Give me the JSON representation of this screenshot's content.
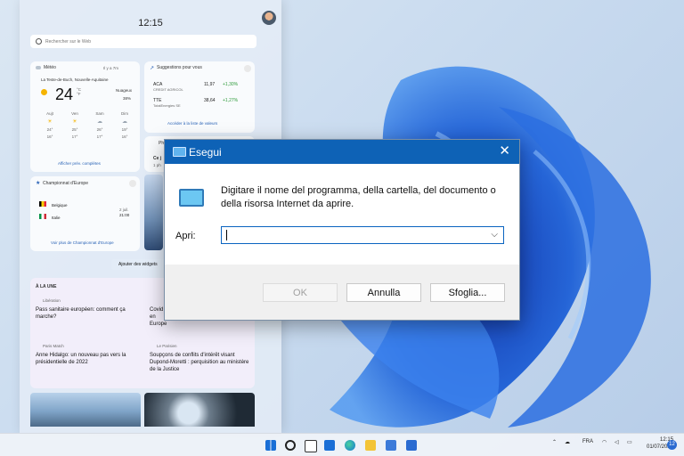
{
  "widgets": {
    "clock": "12:15",
    "search_placeholder": "Rechercher sur le Web",
    "weather": {
      "title": "Météo",
      "updated": "Il y a 7m",
      "location": "La Teste-de-Buch, Nouvelle-Aquitaine",
      "temp": "24",
      "unit": "°C °F",
      "condition": "Nuageux",
      "rain": "38%",
      "days": [
        {
          "name": "Aujt",
          "hi": "24°",
          "lo": "16°"
        },
        {
          "name": "Ven",
          "hi": "25°",
          "lo": "17°"
        },
        {
          "name": "Sam",
          "hi": "26°",
          "lo": "17°"
        },
        {
          "name": "Dim",
          "hi": "19°",
          "lo": "16°"
        }
      ],
      "link": "Afficher prév. complètes"
    },
    "stocks": {
      "title": "Suggestions pour vous",
      "rows": [
        {
          "sym": "ACA",
          "name": "CREDIT AGRICOL",
          "price": "11,97",
          "chg": "+1,30%"
        },
        {
          "sym": "TTE",
          "name": "TotalEnergies SE",
          "price": "38,64",
          "chg": "+1,27%"
        }
      ],
      "link": "Accéder à la liste de valeurs"
    },
    "photos": {
      "title": "Ph",
      "caption": "Ce j",
      "sub": "1 ph"
    },
    "sports": {
      "title": "Championnat d'Europe",
      "team1": "Belgique",
      "team2": "Italie",
      "date": "2 juil.",
      "time": "21:00",
      "link": "Voir plus de Championnat d'Europe"
    },
    "add_widget": "Ajouter des widgets",
    "news": {
      "header": "À LA UNE",
      "items": [
        {
          "source": "Libération",
          "title": "Pass sanitaire européen: comment ça marche?"
        },
        {
          "source": "",
          "title": "Covid en Europe"
        },
        {
          "source": "Paris Match",
          "title": "Anne Hidalgo: un nouveau pas vers la présidentielle de 2022"
        },
        {
          "source": "Le Parisien",
          "title": "Soupçons de conflits d'intérêt visant Dupond-Moretti : perquisition au ministère de la Justice"
        }
      ]
    }
  },
  "dialog": {
    "title": "Esegui",
    "close": "✕",
    "message": "Digitare il nome del programma, della cartella, del documento o della risorsa Internet da aprire.",
    "open_label": "Apri:",
    "open_value": "",
    "ok": "OK",
    "cancel": "Annulla",
    "browse": "Sfoglia..."
  },
  "taskbar": {
    "lang": "FRA",
    "time": "12:15",
    "date": "01/07/2021",
    "notif": "12"
  },
  "colors": {
    "accent": "#0e62b6",
    "wallpaper_bloom": "#1d5fd6"
  }
}
